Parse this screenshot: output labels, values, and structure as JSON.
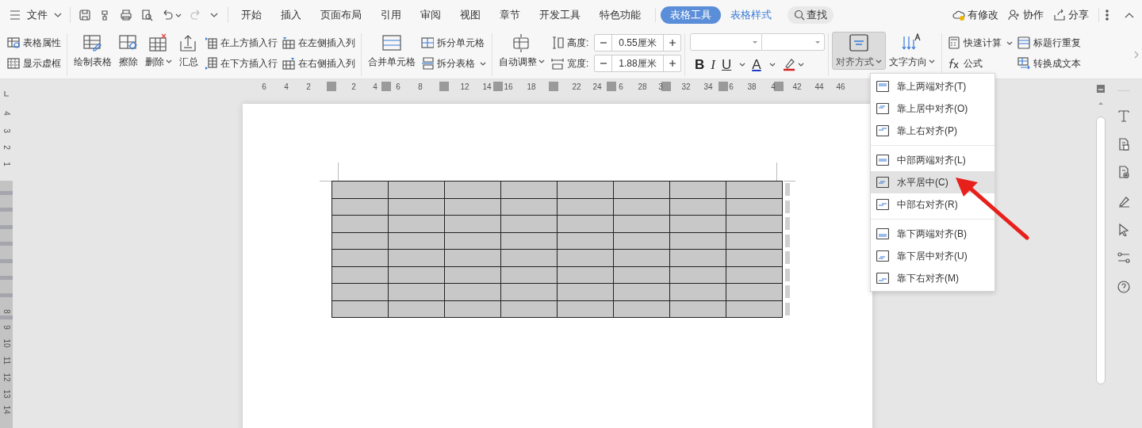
{
  "title_bar": {
    "file_menu": "文件"
  },
  "tabs": [
    {
      "label": "开始",
      "kind": "tab",
      "selected": false
    },
    {
      "label": "插入",
      "kind": "tab",
      "selected": false
    },
    {
      "label": "页面布局",
      "kind": "tab",
      "selected": false
    },
    {
      "label": "引用",
      "kind": "tab",
      "selected": false
    },
    {
      "label": "审阅",
      "kind": "tab",
      "selected": false
    },
    {
      "label": "视图",
      "kind": "tab",
      "selected": false
    },
    {
      "label": "章节",
      "kind": "tab",
      "selected": false
    },
    {
      "label": "开发工具",
      "kind": "tab",
      "selected": false
    },
    {
      "label": "特色功能",
      "kind": "tab",
      "selected": false
    },
    {
      "label": "表格工具",
      "kind": "context",
      "selected": true
    },
    {
      "label": "表格样式",
      "kind": "context",
      "selected": false
    }
  ],
  "search": {
    "label": "查找"
  },
  "top_actions": [
    "有修改",
    "协作",
    "分享"
  ],
  "ribbon": [
    {
      "kind": "stack",
      "items": [
        {
          "label": "表格属性",
          "dropdown": false
        },
        {
          "label": "显示虚框",
          "dropdown": false
        }
      ]
    },
    {
      "kind": "divider"
    },
    {
      "kind": "large",
      "label": "绘制表格",
      "dropdown": false,
      "expanded": false
    },
    {
      "kind": "large",
      "label": "擦除",
      "dropdown": false,
      "expanded": false
    },
    {
      "kind": "large",
      "label": "删除",
      "dropdown": true,
      "expanded": false
    },
    {
      "kind": "large",
      "label": "汇总",
      "dropdown": false,
      "expanded": false
    },
    {
      "kind": "stack",
      "items": [
        {
          "label": "在上方插入行",
          "dropdown": false
        },
        {
          "label": "在下方插入行",
          "dropdown": false
        }
      ]
    },
    {
      "kind": "stack",
      "items": [
        {
          "label": "在左侧插入列",
          "dropdown": false
        },
        {
          "label": "在右侧插入列",
          "dropdown": false
        }
      ]
    },
    {
      "kind": "divider"
    },
    {
      "kind": "large",
      "label": "合并单元格",
      "dropdown": false,
      "expanded": false
    },
    {
      "kind": "stack",
      "items": [
        {
          "label": "拆分单元格",
          "dropdown": false
        },
        {
          "label": "拆分表格",
          "dropdown": true
        }
      ]
    },
    {
      "kind": "divider"
    },
    {
      "kind": "large",
      "label": "自动调整",
      "dropdown": true,
      "expanded": false
    },
    {
      "kind": "spin",
      "items": [
        {
          "label": "高度:",
          "value": "0.55厘米"
        },
        {
          "label": "宽度:",
          "value": "1.88厘米"
        }
      ]
    },
    {
      "kind": "divider"
    },
    {
      "kind": "font",
      "buttons": [
        "B",
        "I",
        "U",
        "A"
      ]
    },
    {
      "kind": "divider"
    },
    {
      "kind": "large",
      "label": "对齐方式",
      "dropdown": true,
      "expanded": true
    },
    {
      "kind": "large",
      "label": "文字方向",
      "dropdown": true,
      "expanded": false
    },
    {
      "kind": "divider"
    },
    {
      "kind": "stack",
      "items": [
        {
          "label": "快速计算",
          "dropdown": true
        },
        {
          "label": "公式",
          "dropdown": false
        }
      ]
    },
    {
      "kind": "stack",
      "items": [
        {
          "label": "标题行重复",
          "dropdown": false
        },
        {
          "label": "转换成文本",
          "dropdown": false
        }
      ]
    }
  ],
  "ruler": {
    "horizontal": [
      "6",
      "4",
      "2",
      "2",
      "4",
      "6",
      "8",
      "12",
      "14",
      "16",
      "18",
      "22",
      "24",
      "6",
      "28",
      "3",
      "32",
      "34",
      "6",
      "38",
      "4",
      "42",
      "44",
      "46"
    ],
    "vertical": [
      "4",
      "3",
      "2",
      "1",
      "8",
      "9",
      "10",
      "11",
      "12",
      "13",
      "14"
    ]
  },
  "align_menu": [
    [
      {
        "label": "靠上两端对齐(T)",
        "selected": false
      },
      {
        "label": "靠上居中对齐(O)",
        "selected": false
      },
      {
        "label": "靠上右对齐(P)",
        "selected": false
      }
    ],
    [
      {
        "label": "中部两端对齐(L)",
        "selected": false
      },
      {
        "label": "水平居中(C)",
        "selected": true
      },
      {
        "label": "中部右对齐(R)",
        "selected": false
      }
    ],
    [
      {
        "label": "靠下两端对齐(B)",
        "selected": false
      },
      {
        "label": "靠下居中对齐(U)",
        "selected": false
      },
      {
        "label": "靠下右对齐(M)",
        "selected": false
      }
    ]
  ]
}
